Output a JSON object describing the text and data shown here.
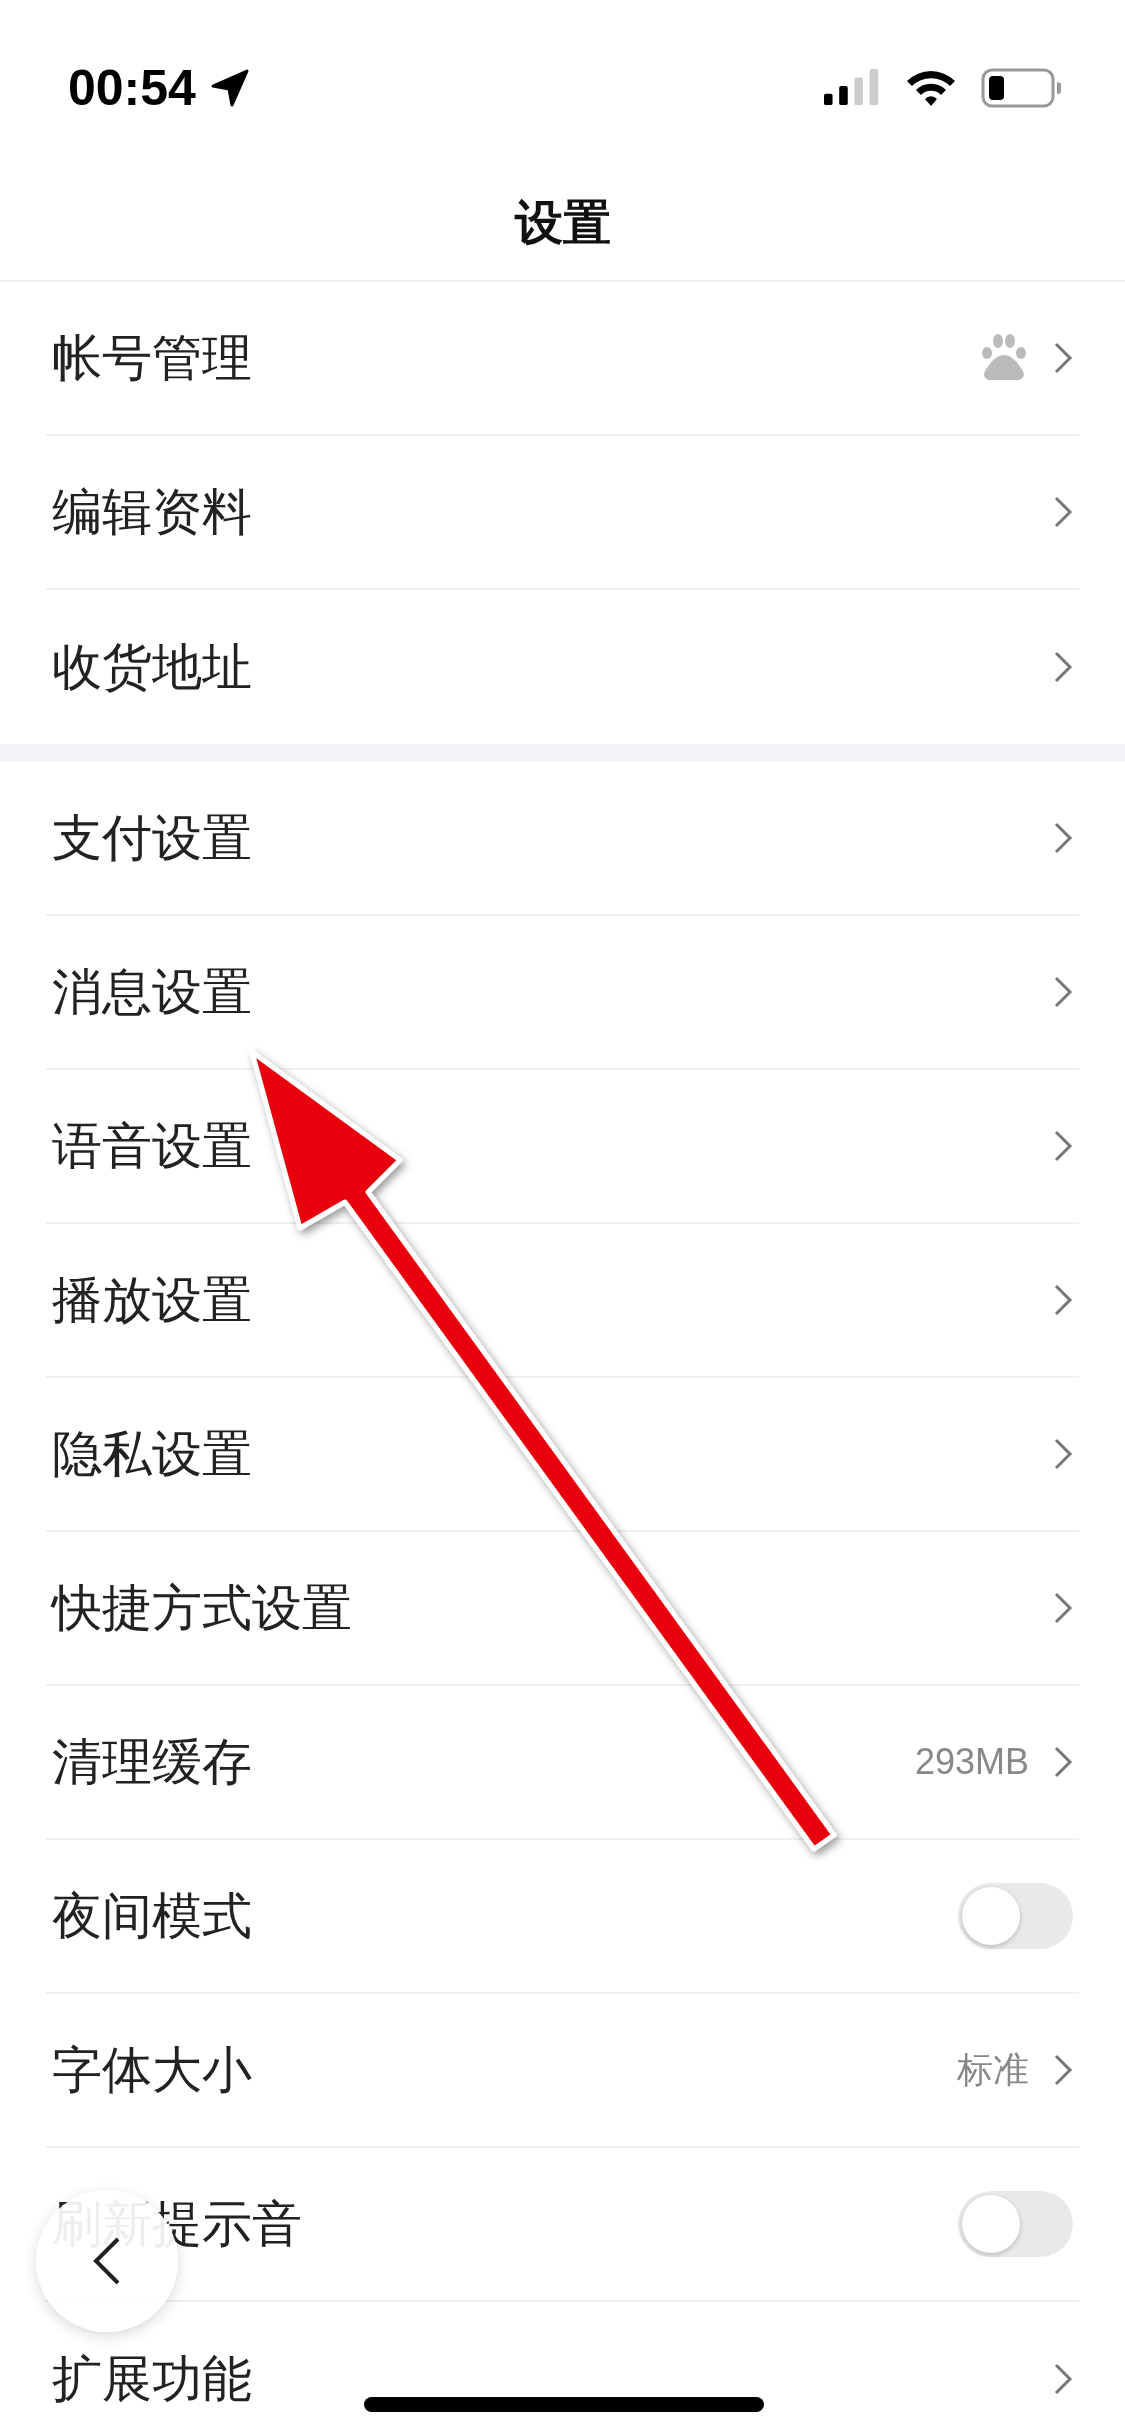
{
  "status_bar": {
    "time": "00:54"
  },
  "title": "设置",
  "sections": [
    {
      "items": [
        {
          "kind": "account",
          "label": "帐号管理"
        },
        {
          "kind": "link",
          "label": "编辑资料"
        },
        {
          "kind": "link",
          "label": "收货地址"
        }
      ]
    },
    {
      "items": [
        {
          "kind": "link",
          "label": "支付设置"
        },
        {
          "kind": "link",
          "label": "消息设置"
        },
        {
          "kind": "link",
          "label": "语音设置"
        },
        {
          "kind": "link",
          "label": "播放设置"
        },
        {
          "kind": "link",
          "label": "隐私设置"
        },
        {
          "kind": "link",
          "label": "快捷方式设置"
        },
        {
          "kind": "link",
          "label": "清理缓存",
          "value": "293MB"
        },
        {
          "kind": "toggle",
          "label": "夜间模式",
          "on": false
        },
        {
          "kind": "link",
          "label": "字体大小",
          "value": "标准"
        },
        {
          "kind": "toggle",
          "label": "刷新提示音",
          "on": false
        },
        {
          "kind": "link",
          "label": "扩展功能"
        }
      ]
    }
  ]
}
